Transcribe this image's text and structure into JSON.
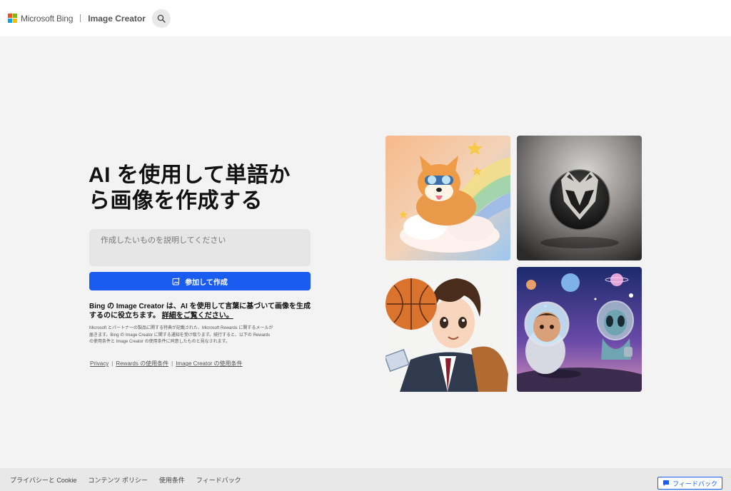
{
  "header": {
    "brand": "Microsoft Bing",
    "app_title": "Image Creator",
    "logo_colors": [
      "#f25022",
      "#7fba00",
      "#00a4ef",
      "#ffb900"
    ]
  },
  "hero": {
    "title": "AI を使用して単語から画像を作成する",
    "prompt_placeholder": "作成したいものを説明してください",
    "create_button": "参加して作成",
    "description": "Bing の Image Creator は、AI を使用して言葉に基づいて画像を生成するのに役立ちます。",
    "details_link": "詳細をご覧ください。",
    "fineprint": "Microsoft とパートナーの製品に関する特典が記載された、Microsoft Rewards に関するメールが届きます。Bing の Image Creator に関する通知を受け取ります。続行すると、以下の Rewards の使用条件と Image Creator の使用条件に同意したものと見なされます。",
    "legal_links": {
      "privacy": "Privacy",
      "rewards_terms": "Rewards の使用条件",
      "creator_terms": "Image Creator の使用条件"
    }
  },
  "gallery": {
    "images": [
      {
        "icon": "corgi-cloud-image"
      },
      {
        "icon": "fox-logo-image"
      },
      {
        "icon": "anime-basketball-image"
      },
      {
        "icon": "astronaut-alien-image"
      }
    ]
  },
  "footer": {
    "links": [
      "プライバシーと Cookie",
      "コンテンツ ポリシー",
      "使用条件",
      "フィードバック"
    ],
    "feedback_button": "フィードバック"
  },
  "colors": {
    "accent": "#1a5cf0",
    "background": "#f3f3f3"
  }
}
